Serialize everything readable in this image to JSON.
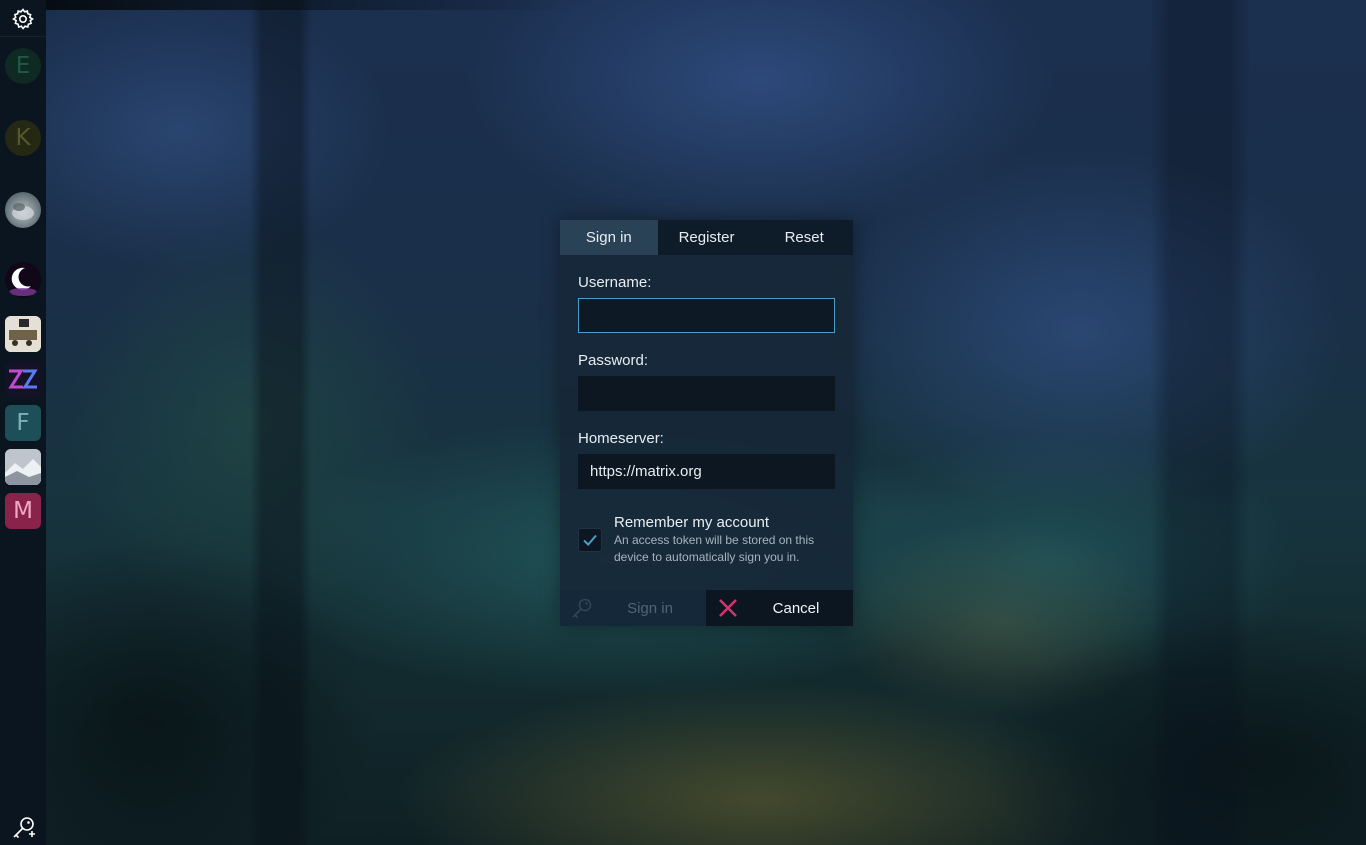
{
  "sidebar": {
    "settings_icon": "gear-icon",
    "items": [
      {
        "type": "letter",
        "letter": "E",
        "bg": "#0f2a23",
        "fg": "#1f5a48"
      },
      {
        "type": "letter",
        "letter": "K",
        "bg": "#252914",
        "fg": "#57582a"
      },
      {
        "type": "avatar",
        "name": "grey-avatar"
      },
      {
        "type": "avatar",
        "name": "moon-avatar"
      },
      {
        "type": "avatar",
        "name": "train-avatar"
      },
      {
        "type": "avatar",
        "name": "zz-avatar"
      },
      {
        "type": "letter",
        "letter": "F",
        "bg": "#1c4f58",
        "fg": "#7ab2bc"
      },
      {
        "type": "avatar",
        "name": "snow-avatar"
      },
      {
        "type": "letter",
        "letter": "M",
        "bg": "#8a2349",
        "fg": "#f0a8c4"
      }
    ],
    "bottom_icon": "key-add-icon"
  },
  "dialog": {
    "tabs": [
      {
        "label": "Sign in",
        "active": true
      },
      {
        "label": "Register",
        "active": false
      },
      {
        "label": "Reset",
        "active": false
      }
    ],
    "username": {
      "label": "Username:",
      "value": ""
    },
    "password": {
      "label": "Password:",
      "value": ""
    },
    "homeserver": {
      "label": "Homeserver:",
      "value": "https://matrix.org"
    },
    "remember": {
      "title": "Remember my account",
      "description": "An access token will be stored on this device to automatically sign you in.",
      "checked": true
    },
    "buttons": {
      "signin_label": "Sign in",
      "signin_icon": "key-icon",
      "cancel_label": "Cancel",
      "cancel_icon": "x-icon"
    }
  },
  "colors": {
    "accent": "#4a9fc7",
    "cancel_icon": "#d6336c",
    "check": "#4a9fc7"
  }
}
